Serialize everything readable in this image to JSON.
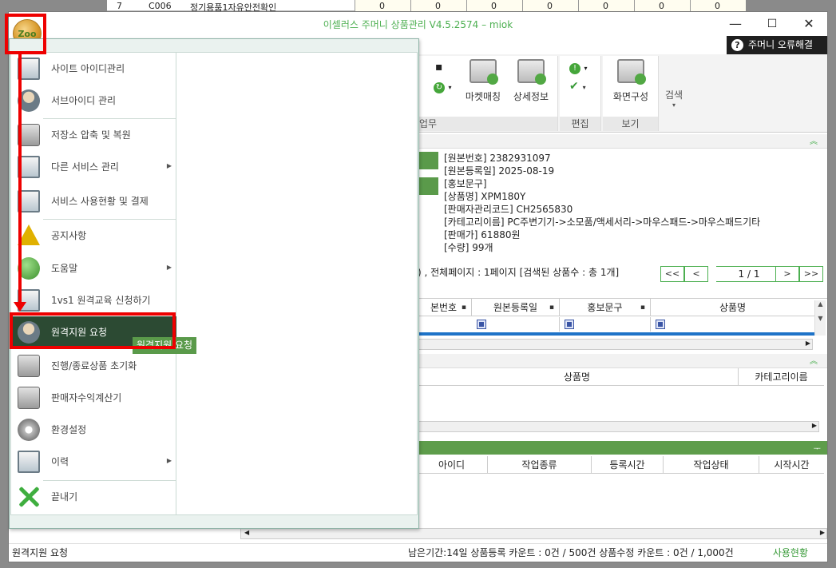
{
  "background": {
    "row_number": "7",
    "code": "C006",
    "item": "정기용품1자유안전확인",
    "values": [
      "0",
      "0",
      "0",
      "0",
      "0",
      "0",
      "0"
    ]
  },
  "window": {
    "title": "이셀러스 주머니 상품관리 V4.5.2574 – miok",
    "logo_text": "Zoo",
    "minimize": "—",
    "maximize": "☐",
    "close": "✕"
  },
  "help_bar": {
    "icon": "?",
    "label": "주머니 오류해결"
  },
  "ribbon": {
    "groups": [
      {
        "label": "업무",
        "buttons": [
          "마켓매칭",
          "상세정보"
        ]
      },
      {
        "label": "편집",
        "buttons": []
      },
      {
        "label": "보기",
        "buttons": [
          "화면구성"
        ]
      }
    ],
    "search_label": "검색",
    "dropdown_arrow": "▾"
  },
  "detail": {
    "lines": [
      "[원본번호]  2382931097",
      "[원본등록일]  2025-08-19",
      "[홍보문구]",
      "[상품명]  XPM180Y",
      "[판매자관리코드]  CH2565830",
      "[카테고리이름]  PC주변기기->소모품/액세서리->마우스패드->마우스패드기타",
      "[판매가]  61880원",
      "[수량]  99개"
    ]
  },
  "pager": {
    "info": ") , 전체페이지 : 1페이지  [검색된 상품수 : 총 1개]",
    "first": "<<",
    "prev": "<",
    "page": "1 / 1",
    "next": ">",
    "last": ">>"
  },
  "grid1": {
    "headers": [
      "본번호",
      "원본등록일",
      "홍보문구",
      "상품명"
    ]
  },
  "grid2": {
    "headers": [
      "상품명",
      "카테고리이름"
    ]
  },
  "grid3": {
    "headers": [
      "아이디",
      "작업종류",
      "등록시간",
      "작업상태",
      "시작시간"
    ]
  },
  "status": {
    "left": "원격지원 요청",
    "right": "남은기간:14일  상품등록 카운트 : 0건 / 500건  상품수정 카운트 : 0건 / 1,000건",
    "usage": "사용현황"
  },
  "menu": {
    "items": [
      {
        "label": "사이트 아이디관리"
      },
      {
        "label": "서브아이디 관리"
      },
      {
        "label": "저장소 압축 및 복원"
      },
      {
        "label": "다른 서비스 관리"
      },
      {
        "label": "서비스 사용현황 및 결제"
      },
      {
        "label": "공지사항"
      },
      {
        "label": "도움말"
      },
      {
        "label": "1vs1 원격교육 신청하기"
      },
      {
        "label": "원격지원 요청"
      },
      {
        "label": "진행/종료상품 초기화"
      },
      {
        "label": "판매자수익계산기"
      },
      {
        "label": "환경설정"
      },
      {
        "label": "이력"
      },
      {
        "label": "끝내기"
      }
    ],
    "submenu_arrow": "▶",
    "tooltip": "원격지원 요청"
  },
  "colors": {
    "accent": "#4caf50",
    "highlight": "#2c4a33",
    "annotation": "#e00000"
  }
}
